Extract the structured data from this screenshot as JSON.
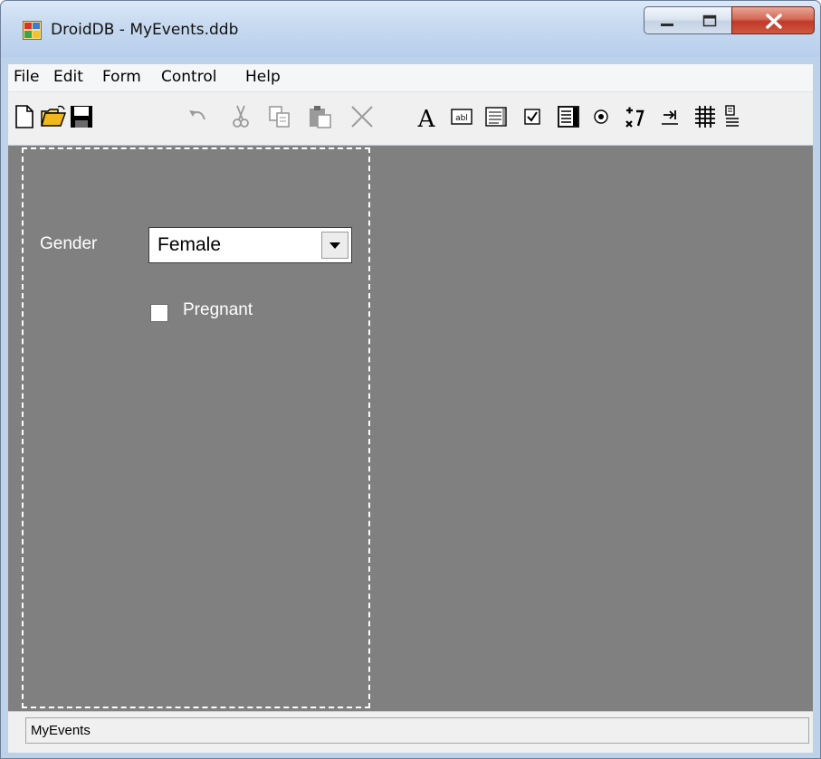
{
  "window": {
    "title": "DroidDB - MyEvents.ddb",
    "caption_buttons": [
      "minimize-icon",
      "maximize-icon",
      "close-icon"
    ],
    "accent_colors": {
      "titlebar": "#c6d9f0",
      "close_button": "#c2392a",
      "client_area": "#808080"
    }
  },
  "menu": {
    "items": [
      "File",
      "Edit",
      "Form",
      "Control",
      "Help"
    ]
  },
  "toolbar": {
    "icons": [
      "new-file-icon",
      "open-folder-icon",
      "save-icon",
      "undo-icon",
      "cut-icon",
      "copy-icon",
      "paste-icon",
      "delete-icon",
      "label-tool-icon",
      "textbox-tool-icon",
      "memo-tool-icon",
      "checkbox-tool-icon",
      "listbox-tool-icon",
      "radio-tool-icon",
      "spinner-tool-icon",
      "tab-order-icon",
      "grid-tool-icon",
      "more-tools-icon"
    ],
    "label_glyph": "A",
    "textbox_glyph": "abl"
  },
  "form": {
    "gender_label": "Gender",
    "gender_value": "Female",
    "pregnant_label": "Pregnant",
    "pregnant_checked": false
  },
  "status": {
    "text": "MyEvents"
  }
}
